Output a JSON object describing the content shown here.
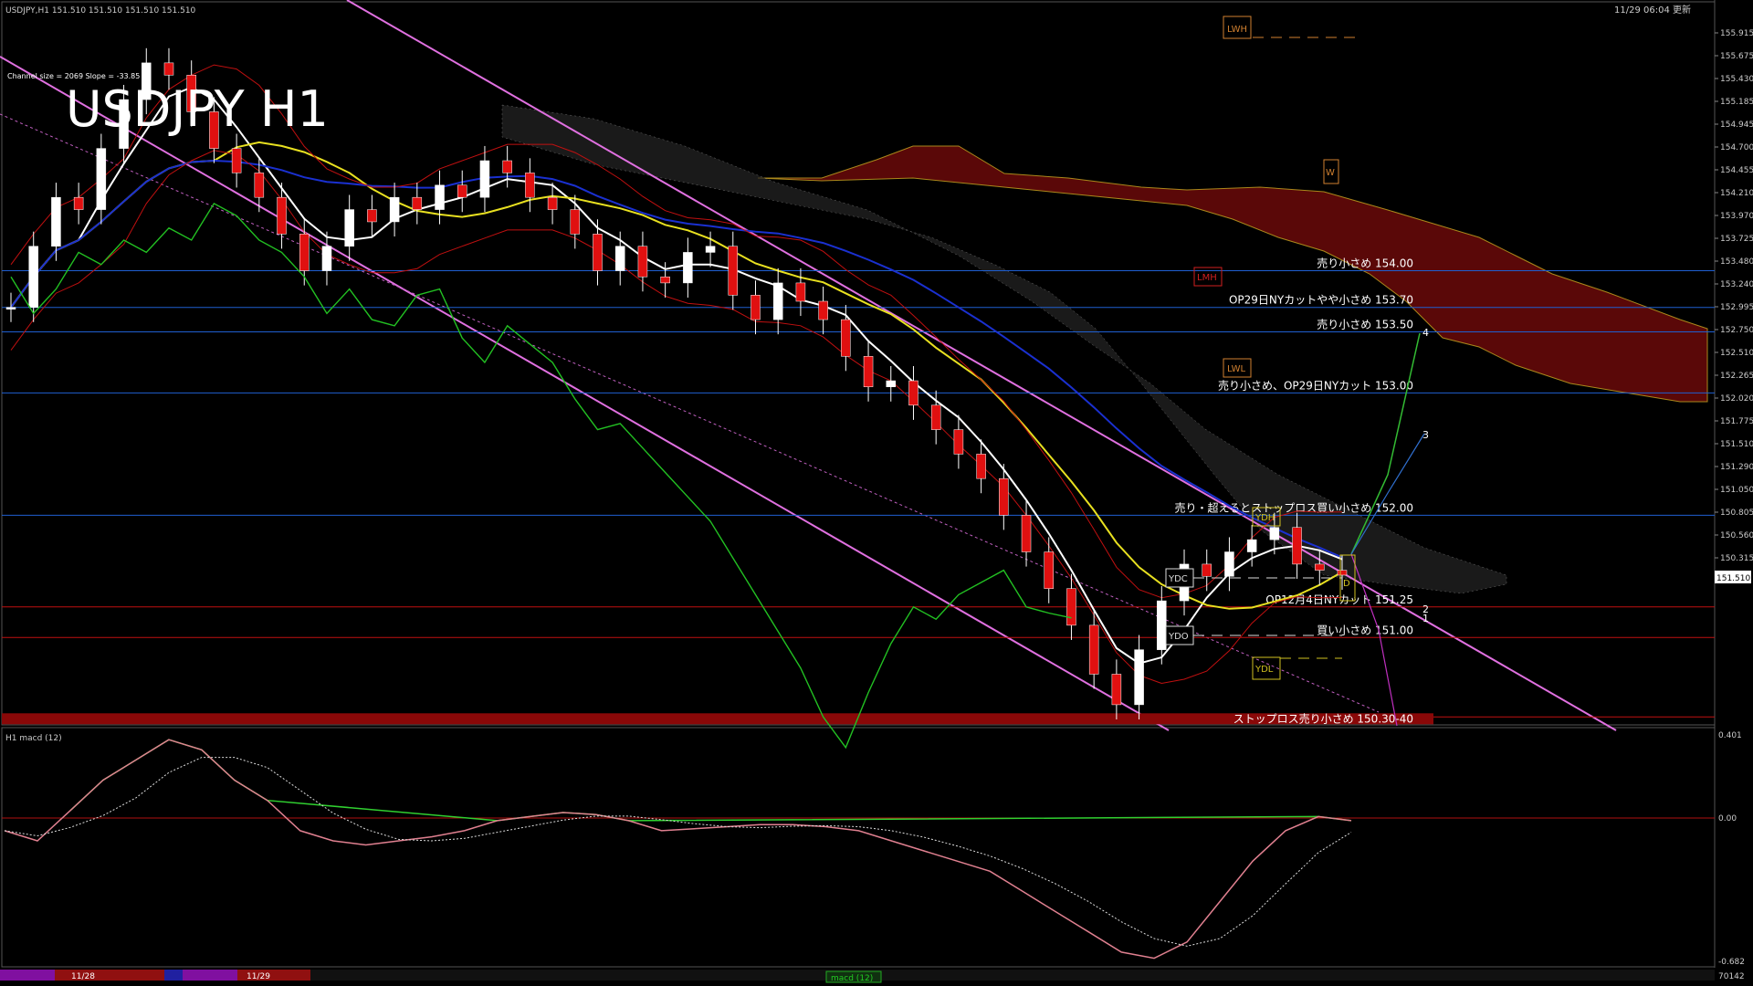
{
  "header": {
    "symbol_info": "USDJPY,H1  151.510 151.510 151.510 151.510",
    "big_title": "USDJPY H1",
    "channel_info": "Channel size = 2069 Slope = -33.85",
    "datetime": "11/29 06:04 更新"
  },
  "price_axis": {
    "ticks": [
      "155.915",
      "155.675",
      "155.430",
      "155.185",
      "154.945",
      "154.700",
      "154.455",
      "154.210",
      "153.970",
      "153.725",
      "153.480",
      "153.240",
      "152.995",
      "152.750",
      "152.510",
      "152.265",
      "152.020",
      "151.775",
      "151.510",
      "151.290",
      "151.050",
      "150.805",
      "150.560",
      "150.315"
    ],
    "current_price": "151.510"
  },
  "macd_panel": {
    "title": "H1  macd (12)",
    "scale_top": "0.401",
    "scale_zero": "0.00",
    "scale_bottom": "-0.682"
  },
  "bottom_bar": {
    "date_1": "11/28",
    "date_2": "11/29",
    "indicator_tab": "macd (12)",
    "bars_count": "70142"
  },
  "level_boxes": {
    "lwh": "LWH",
    "lmh": "LMH",
    "lwl": "LWL",
    "ydh": "YDH",
    "ydc": "YDC",
    "ydo": "YDO",
    "ydl": "YDL",
    "d": "D",
    "w": "W"
  },
  "projection_labels": {
    "p1": "1",
    "p2": "2",
    "p3": "3",
    "p4": "4"
  },
  "chart_data": {
    "type": "candlestick",
    "title": "USDJPY H1",
    "y_range": [
      150.3,
      156.05
    ],
    "macd_range": [
      -0.682,
      0.401
    ],
    "levels": [
      {
        "price": 154.0,
        "label": "売り小さめ 154.00",
        "color": "#1f5fd0"
      },
      {
        "price": 153.7,
        "label": "OP29日NYカットやや小さめ 153.70",
        "color": "#1f5fd0"
      },
      {
        "price": 153.5,
        "label": "売り小さめ 153.50",
        "color": "#1f5fd0"
      },
      {
        "price": 153.0,
        "label": "売り小さめ、OP29日NYカット 153.00",
        "color": "#1f5fd0"
      },
      {
        "price": 152.0,
        "label": "売り・超えるとストップロス買い小さめ 152.00",
        "color": "#1f5fd0"
      },
      {
        "price": 151.25,
        "label": "OP12月4日NYカット 151.25",
        "color": "#c01010"
      },
      {
        "price": 151.0,
        "label": "買い小さめ 151.00",
        "color": "#c01010"
      },
      {
        "price": 150.35,
        "label": "ストップロス売り小さめ 150.30-40",
        "color": "#c01010"
      }
    ],
    "closes": [
      153.7,
      154.2,
      154.6,
      154.5,
      155.0,
      155.4,
      155.7,
      155.6,
      155.3,
      155.0,
      154.8,
      154.6,
      154.3,
      154.0,
      154.2,
      154.5,
      154.4,
      154.6,
      154.5,
      154.7,
      154.6,
      154.9,
      154.8,
      154.6,
      154.5,
      154.3,
      154.0,
      154.2,
      153.95,
      153.9,
      154.15,
      154.2,
      153.8,
      153.6,
      153.9,
      153.75,
      153.6,
      153.3,
      153.05,
      153.1,
      152.9,
      152.7,
      152.5,
      152.3,
      152.0,
      151.7,
      151.4,
      151.1,
      150.7,
      150.45,
      150.9,
      151.3,
      151.6,
      151.5,
      151.7,
      151.8,
      151.9,
      151.6,
      151.55,
      151.51
    ],
    "macd": [
      -0.05,
      -0.1,
      0.05,
      0.2,
      0.3,
      0.4,
      0.35,
      0.2,
      0.1,
      -0.05,
      -0.1,
      -0.12,
      -0.1,
      -0.08,
      -0.05,
      0.0,
      0.02,
      0.04,
      0.03,
      0.0,
      -0.05,
      -0.04,
      -0.03,
      -0.02,
      -0.02,
      -0.03,
      -0.05,
      -0.1,
      -0.15,
      -0.2,
      -0.25,
      -0.35,
      -0.45,
      -0.55,
      -0.65,
      -0.68,
      -0.6,
      -0.4,
      -0.2,
      -0.05,
      0.02,
      0.0
    ]
  }
}
